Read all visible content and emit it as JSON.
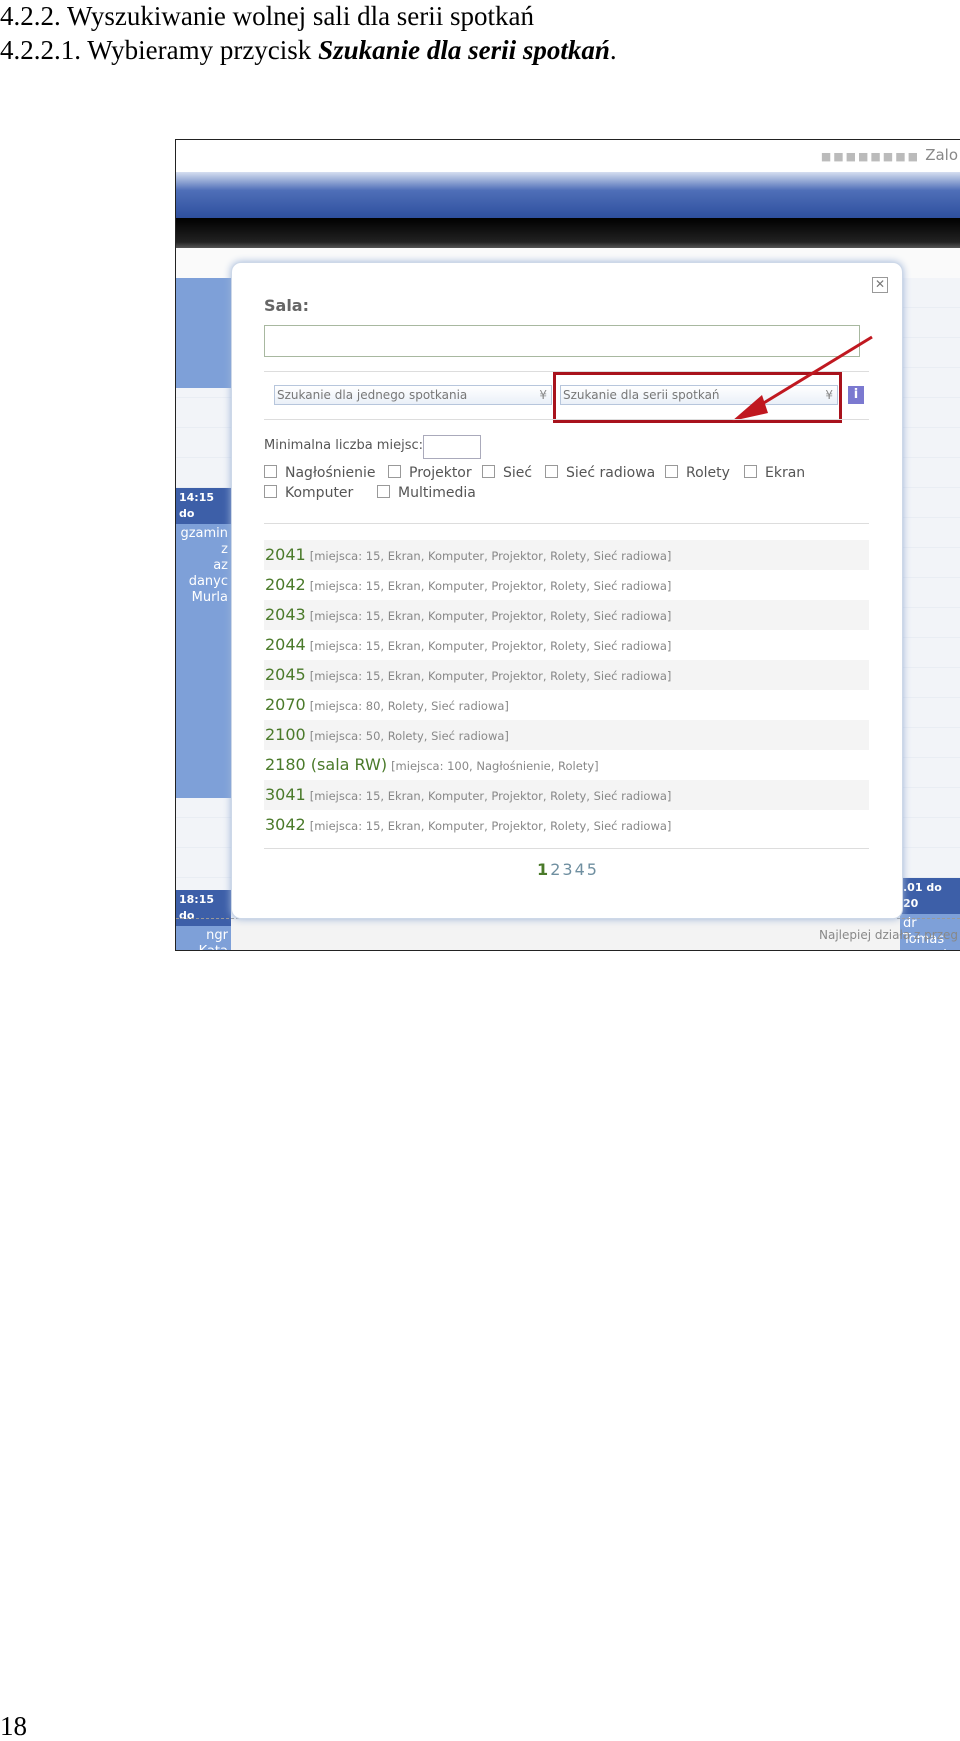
{
  "doc": {
    "heading": "4.2.2. Wyszukiwanie wolnej sali dla serii spotkań",
    "step_prefix": "4.2.2.1. Wybieramy przycisk ",
    "step_emph": "Szukanie dla serii spotkań",
    "step_suffix": ".",
    "page_number": "18"
  },
  "app": {
    "login_link": "Zalo",
    "footer_text": "Najlepiej działa z przeg",
    "events": [
      {
        "head": "14:15 do",
        "body": "gzamin z\naz danyc\nMurla"
      },
      {
        "head": "18:15 do",
        "body": "ngr Kata\nDudek"
      },
      {
        "head": ".01 do 20",
        "body": "dr Tomas\nawczyk"
      }
    ]
  },
  "modal": {
    "close_glyph": "✕",
    "sala_label": "Sala:",
    "sala_value": "",
    "select_single": "Szukanie dla jednego spotkania",
    "select_series": "Szukanie dla serii spotkań",
    "info_glyph": "i",
    "min_label": "Minimalna liczba miejsc:",
    "min_value": "",
    "checkboxes": [
      "Nagłośnienie",
      "Projektor",
      "Sieć",
      "Sieć radiowa",
      "Rolety",
      "Ekran",
      "Komputer",
      "Multimedia"
    ],
    "rooms": [
      {
        "num": "2041",
        "desc": "[miejsca: 15, Ekran, Komputer, Projektor, Rolety, Sieć radiowa]"
      },
      {
        "num": "2042",
        "desc": "[miejsca: 15, Ekran, Komputer, Projektor, Rolety, Sieć radiowa]"
      },
      {
        "num": "2043",
        "desc": "[miejsca: 15, Ekran, Komputer, Projektor, Rolety, Sieć radiowa]"
      },
      {
        "num": "2044",
        "desc": "[miejsca: 15, Ekran, Komputer, Projektor, Rolety, Sieć radiowa]"
      },
      {
        "num": "2045",
        "desc": "[miejsca: 15, Ekran, Komputer, Projektor, Rolety, Sieć radiowa]"
      },
      {
        "num": "2070",
        "desc": "[miejsca: 80, Rolety, Sieć radiowa]"
      },
      {
        "num": "2100",
        "desc": "[miejsca: 50, Rolety, Sieć radiowa]"
      },
      {
        "num": "2180 (sala RW)",
        "desc": "[miejsca: 100, Nagłośnienie, Rolety]"
      },
      {
        "num": "3041",
        "desc": "[miejsca: 15, Ekran, Komputer, Projektor, Rolety, Sieć radiowa]"
      },
      {
        "num": "3042",
        "desc": "[miejsca: 15, Ekran, Komputer, Projektor, Rolety, Sieć radiowa]"
      }
    ],
    "pages": [
      "1",
      "2",
      "3",
      "4",
      "5"
    ],
    "current_page": "1"
  },
  "colors": {
    "highlight": "#a8121c",
    "room_number": "#4a7a2a"
  }
}
